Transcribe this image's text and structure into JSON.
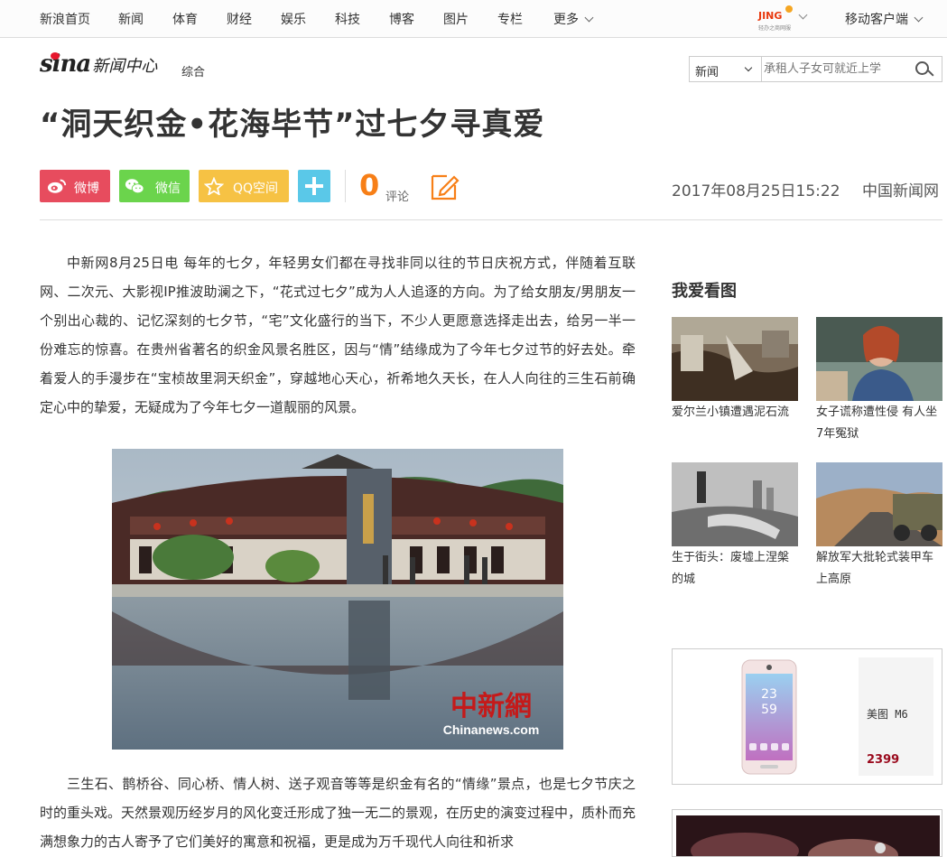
{
  "topnav": {
    "items": [
      "新浪首页",
      "新闻",
      "体育",
      "财经",
      "娱乐",
      "科技",
      "博客",
      "图片",
      "专栏",
      "更多"
    ],
    "jing_logo_text": "JING",
    "jing_logo_sub": "轻办之商网服",
    "mobile_client": "移动客户端"
  },
  "header": {
    "logo_text": "sina",
    "logo_center": "新闻中心",
    "channel": "综合",
    "search_category": "新闻",
    "search_placeholder": "承租人子女可就近上学"
  },
  "article": {
    "title": "“洞天织金•花海毕节”过七夕寻真爱",
    "share": {
      "weibo": "微博",
      "weixin": "微信",
      "qzone": "QQ空间"
    },
    "comment_count": "0",
    "comment_label": "评论",
    "date": "2017年08月25日15:22",
    "source": "中国新闻网",
    "paragraph1": "中新网8月25日电 每年的七夕，年轻男女们都在寻找非同以往的节日庆祝方式，伴随着互联网、二次元、大影视IP推波助澜之下，“花式过七夕”成为人人追逐的方向。为了给女朋友/男朋友一个别出心裁的、记忆深刻的七夕节，“宅”文化盛行的当下，不少人更愿意选择走出去，给另一半一份难忘的惊喜。在贵州省著名的织金风景名胜区，因与“情”结缘成为了今年七夕过节的好去处。牵着爱人的手漫步在“宝桢故里洞天织金”，穿越地心天心，祈希地久天长，在人人向往的三生石前确定心中的挚爱，无疑成为了今年七夕一道靓丽的风景。",
    "photo_watermark_cn": "中新網",
    "photo_watermark_en": "Chinanews.com",
    "paragraph2": "三生石、鹊桥谷、同心桥、情人树、送子观音等等是织金有名的“情缘”景点，也是七夕节庆之时的重头戏。天然景观历经岁月的风化变迁形成了独一无二的景观，在历史的演变过程中，质朴而充满想象力的古人寄予了它们美好的寓意和祝福，更是成为万千现代人向往和祈求"
  },
  "sidebar": {
    "title": "我爱看图",
    "pics": [
      {
        "caption": "爱尔兰小镇遭遇泥石流"
      },
      {
        "caption": "女子谎称遭性侵 有人坐7年冤狱"
      },
      {
        "caption": "生于街头：废墟上涅槃的城"
      },
      {
        "caption": "解放军大批轮式装甲车上高原"
      }
    ],
    "ad": {
      "product": "美图 M6",
      "price": "2399",
      "phone_time": "23\n59"
    }
  }
}
